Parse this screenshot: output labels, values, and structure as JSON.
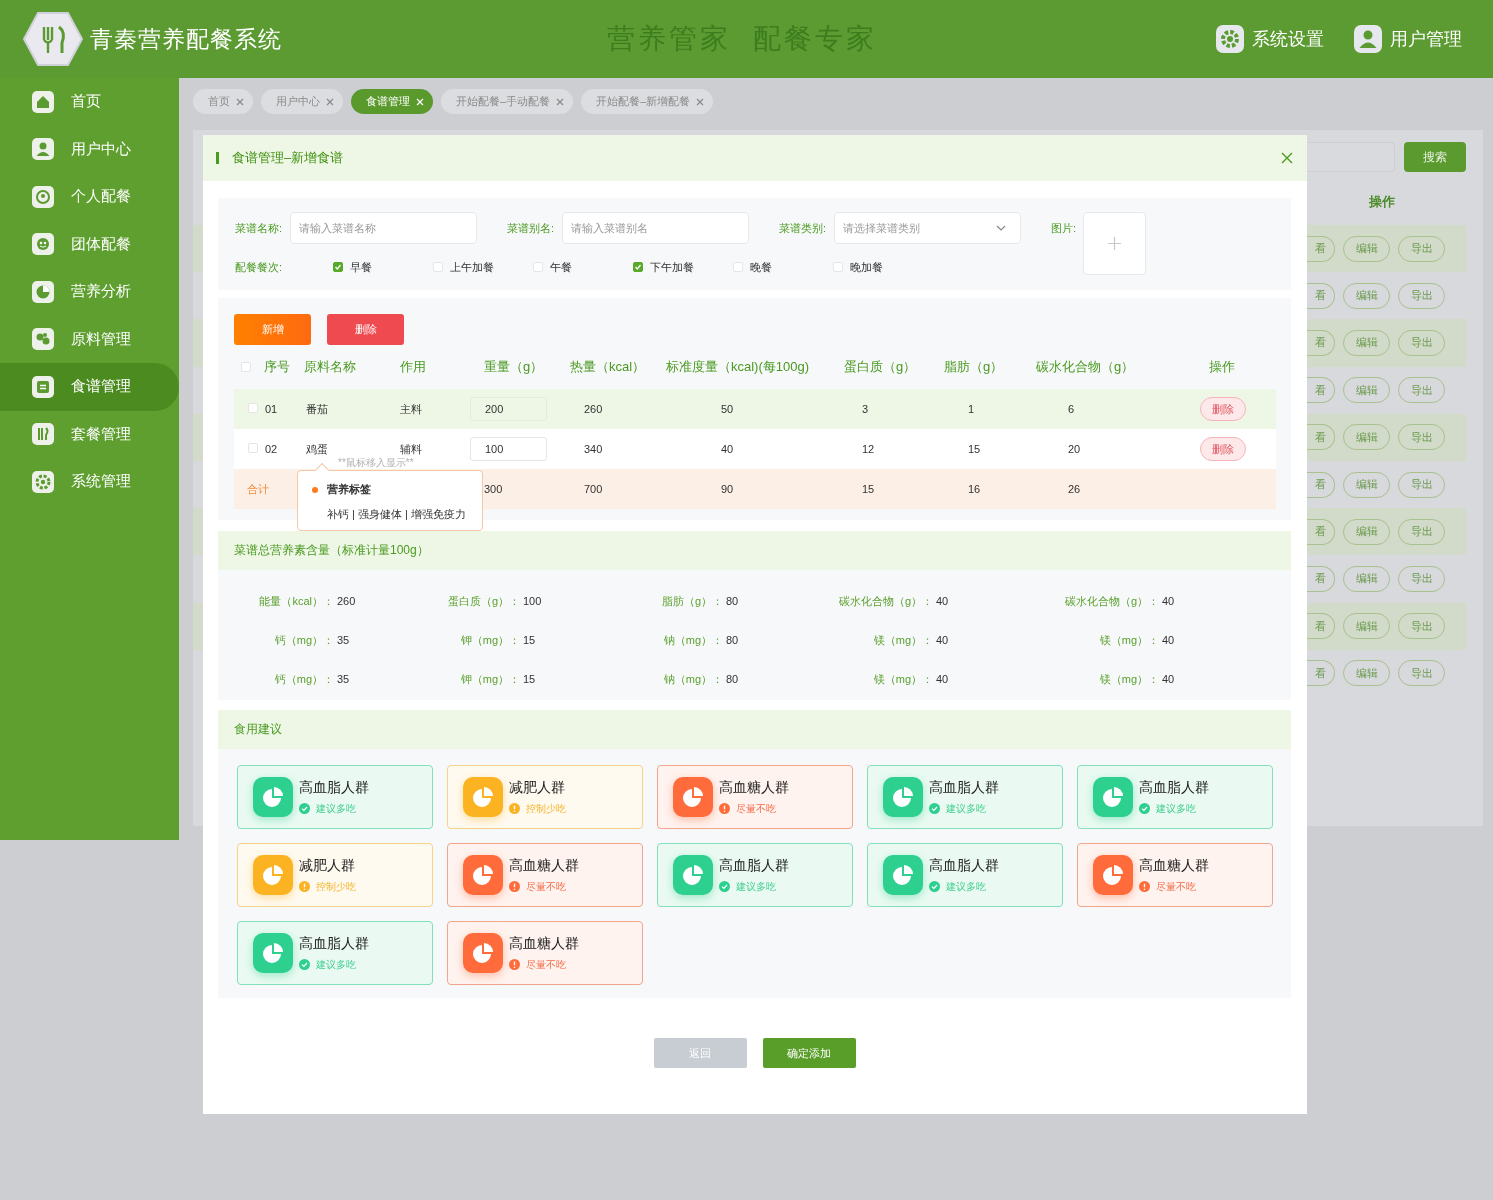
{
  "header": {
    "title": "青秦营养配餐系统",
    "slogan": [
      "营养管家",
      "配餐专家"
    ],
    "actions": [
      {
        "label": "系统设置"
      },
      {
        "label": "用户管理"
      }
    ]
  },
  "sidebar": {
    "items": [
      {
        "label": "首页",
        "selected": false
      },
      {
        "label": "用户中心",
        "selected": false
      },
      {
        "label": "个人配餐",
        "selected": false
      },
      {
        "label": "团体配餐",
        "selected": false
      },
      {
        "label": "营养分析",
        "selected": false
      },
      {
        "label": "原料管理",
        "selected": false
      },
      {
        "label": "食谱管理",
        "selected": true
      },
      {
        "label": "套餐管理",
        "selected": false
      },
      {
        "label": "系统管理",
        "selected": false
      }
    ]
  },
  "tabs": [
    {
      "label": "首页",
      "selected": false
    },
    {
      "label": "用户中心",
      "selected": false
    },
    {
      "label": "食谱管理",
      "selected": true
    },
    {
      "label": "开始配餐–手动配餐",
      "selected": false
    },
    {
      "label": "开始配餐–新增配餐",
      "selected": false
    }
  ],
  "background": {
    "search_button": "搜索",
    "column_header": "操作",
    "rows": [
      {
        "actions": [
          "看",
          "编辑",
          "导出"
        ]
      },
      {
        "actions": [
          "看",
          "编辑",
          "导出"
        ]
      },
      {
        "actions": [
          "看",
          "编辑",
          "导出"
        ]
      },
      {
        "actions": [
          "看",
          "编辑",
          "导出"
        ]
      },
      {
        "actions": [
          "看",
          "编辑",
          "导出"
        ]
      },
      {
        "actions": [
          "看",
          "编辑",
          "导出"
        ]
      },
      {
        "actions": [
          "看",
          "编辑",
          "导出"
        ]
      },
      {
        "actions": [
          "看",
          "编辑",
          "导出"
        ]
      },
      {
        "actions": [
          "看",
          "编辑",
          "导出"
        ]
      },
      {
        "actions": [
          "看",
          "编辑",
          "导出"
        ]
      }
    ]
  },
  "modal": {
    "title": "食谱管理–新增食谱",
    "form": {
      "fields": [
        {
          "label": "菜谱名称:",
          "kind": "input",
          "placeholder": "请输入菜谱名称"
        },
        {
          "label": "菜谱别名:",
          "kind": "input",
          "placeholder": "请输入菜谱别名"
        },
        {
          "label": "菜谱类别:",
          "kind": "select",
          "placeholder": "请选择菜谱类别"
        },
        {
          "label": "图片:",
          "kind": "upload"
        }
      ],
      "meals": {
        "label": "配餐餐次:",
        "options": [
          {
            "label": "早餐",
            "checked": true
          },
          {
            "label": "上午加餐",
            "checked": false
          },
          {
            "label": "午餐",
            "checked": false
          },
          {
            "label": "下午加餐",
            "checked": true
          },
          {
            "label": "晚餐",
            "checked": false
          },
          {
            "label": "晚加餐",
            "checked": false
          }
        ]
      }
    },
    "table": {
      "buttons": [
        {
          "label": "新增",
          "kind": "add"
        },
        {
          "label": "删除",
          "kind": "delete"
        }
      ],
      "all_checked": false,
      "columns": [
        "序号",
        "原料名称",
        "作用",
        "重量（g）",
        "热量（kcal）",
        "标准度量（kcal)(每100g)",
        "蛋白质（g）",
        "脂肪（g）",
        "碳水化合物（g）",
        "操作"
      ],
      "rows": [
        {
          "checked": false,
          "cells": [
            "01",
            "番茄",
            "主料",
            "200",
            "260",
            "50",
            "3",
            "1",
            "6"
          ],
          "action": "删除"
        },
        {
          "checked": false,
          "cells": [
            "02",
            "鸡蛋",
            "辅料",
            "100",
            "340",
            "40",
            "12",
            "15",
            "20"
          ],
          "action": "删除",
          "hint": "**鼠标移入显示**"
        }
      ],
      "total": {
        "label": "合计",
        "cells": [
          "300",
          "700",
          "90",
          "15",
          "16",
          "26"
        ]
      },
      "tooltip": {
        "title": "营养标签",
        "text": "补钙 | 强身健体 | 增强免疫力"
      }
    },
    "nutrition": {
      "title": "菜谱总营养素含量（标准计量100g）",
      "rows": [
        [
          {
            "label": "能量（kcal）：",
            "value": "260"
          },
          {
            "label": "蛋白质（g）：",
            "value": "100"
          },
          {
            "label": "脂肪（g）：",
            "value": "80"
          },
          {
            "label": "碳水化合物（g）：",
            "value": "40"
          },
          {
            "label": "碳水化合物（g）：",
            "value": "40"
          }
        ],
        [
          {
            "label": "钙（mg）：",
            "value": "35"
          },
          {
            "label": "钾（mg）：",
            "value": "15"
          },
          {
            "label": "钠（mg）：",
            "value": "80"
          },
          {
            "label": "镁（mg）：",
            "value": "40"
          },
          {
            "label": "镁（mg）：",
            "value": "40"
          }
        ],
        [
          {
            "label": "钙（mg）：",
            "value": "35"
          },
          {
            "label": "钾（mg）：",
            "value": "15"
          },
          {
            "label": "钠（mg）：",
            "value": "80"
          },
          {
            "label": "镁（mg）：",
            "value": "40"
          },
          {
            "label": "镁（mg）：",
            "value": "40"
          }
        ]
      ]
    },
    "advice": {
      "title": "食用建议",
      "cards": [
        {
          "title": "高血脂人群",
          "status": "建议多吃",
          "kind": "recommend"
        },
        {
          "title": "减肥人群",
          "status": "控制少吃",
          "kind": "limit"
        },
        {
          "title": "高血糖人群",
          "status": "尽量不吃",
          "kind": "avoid"
        },
        {
          "title": "高血脂人群",
          "status": "建议多吃",
          "kind": "recommend"
        },
        {
          "title": "高血脂人群",
          "status": "建议多吃",
          "kind": "recommend"
        },
        {
          "title": "减肥人群",
          "status": "控制少吃",
          "kind": "limit"
        },
        {
          "title": "高血糖人群",
          "status": "尽量不吃",
          "kind": "avoid"
        },
        {
          "title": "高血脂人群",
          "status": "建议多吃",
          "kind": "recommend"
        },
        {
          "title": "高血脂人群",
          "status": "建议多吃",
          "kind": "recommend"
        },
        {
          "title": "高血糖人群",
          "status": "尽量不吃",
          "kind": "avoid"
        },
        {
          "title": "高血脂人群",
          "status": "建议多吃",
          "kind": "recommend"
        },
        {
          "title": "高血糖人群",
          "status": "尽量不吃",
          "kind": "avoid"
        }
      ]
    },
    "footer": {
      "buttons": [
        {
          "label": "返回",
          "kind": "secondary"
        },
        {
          "label": "确定添加",
          "kind": "primary"
        }
      ]
    }
  }
}
